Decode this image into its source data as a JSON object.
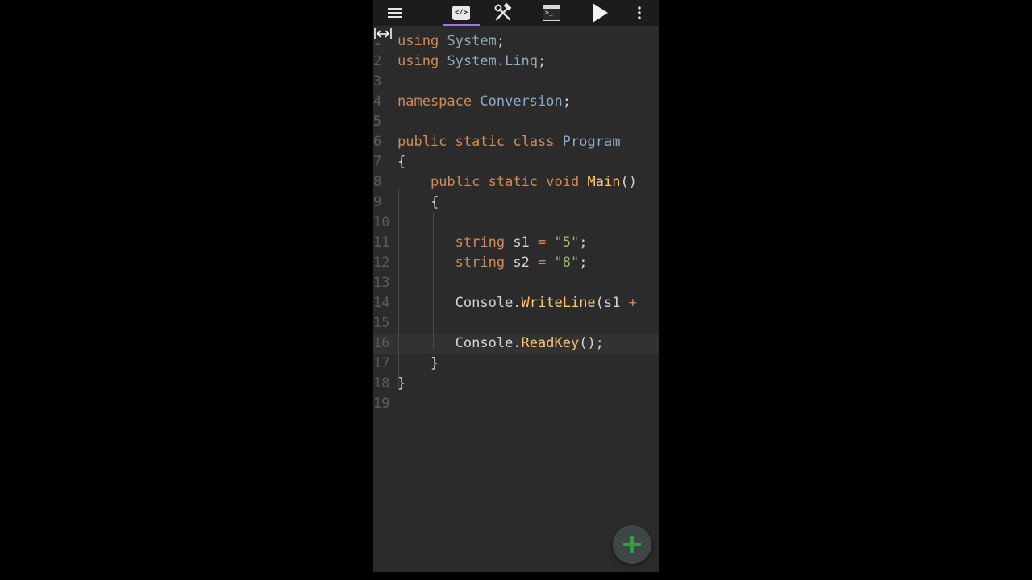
{
  "toolbar": {
    "menu_icon": "hamburger-menu-icon",
    "code_tab_icon": "code-icon",
    "code_tab_glyph": "</>",
    "build_icon": "hammer-wrench-icon",
    "console_icon": "terminal-icon",
    "console_glyph": ">_",
    "run_icon": "play-icon",
    "more_icon": "more-vertical-icon",
    "accent_color": "#9d7ad6"
  },
  "editor": {
    "resize_icon": "resize-horizontal-icon",
    "highlighted_line": 16,
    "lines": [
      {
        "number": "1",
        "tokens": [
          {
            "t": "using",
            "c": "kw"
          },
          {
            "t": " ",
            "c": "pl"
          },
          {
            "t": "System",
            "c": "ty"
          },
          {
            "t": ";",
            "c": "pl"
          }
        ]
      },
      {
        "number": "2",
        "tokens": [
          {
            "t": "using",
            "c": "kw"
          },
          {
            "t": " ",
            "c": "pl"
          },
          {
            "t": "System.Linq",
            "c": "ty"
          },
          {
            "t": ";",
            "c": "pl"
          }
        ]
      },
      {
        "number": "3",
        "tokens": []
      },
      {
        "number": "4",
        "tokens": [
          {
            "t": "namespace",
            "c": "kw"
          },
          {
            "t": " ",
            "c": "pl"
          },
          {
            "t": "Conversion",
            "c": "ty"
          },
          {
            "t": ";",
            "c": "pl"
          }
        ]
      },
      {
        "number": "5",
        "tokens": []
      },
      {
        "number": "6",
        "tokens": [
          {
            "t": "public",
            "c": "kw"
          },
          {
            "t": " ",
            "c": "pl"
          },
          {
            "t": "static",
            "c": "kw"
          },
          {
            "t": " ",
            "c": "pl"
          },
          {
            "t": "class",
            "c": "kw"
          },
          {
            "t": " ",
            "c": "pl"
          },
          {
            "t": "Program",
            "c": "ty"
          }
        ]
      },
      {
        "number": "7",
        "tokens": [
          {
            "t": "{",
            "c": "pl"
          }
        ]
      },
      {
        "number": "8",
        "tokens": [
          {
            "t": "    ",
            "c": "pl"
          },
          {
            "t": "public",
            "c": "kw"
          },
          {
            "t": " ",
            "c": "pl"
          },
          {
            "t": "static",
            "c": "kw"
          },
          {
            "t": " ",
            "c": "pl"
          },
          {
            "t": "void",
            "c": "kw"
          },
          {
            "t": " ",
            "c": "pl"
          },
          {
            "t": "Main",
            "c": "fn"
          },
          {
            "t": "()",
            "c": "pl"
          }
        ]
      },
      {
        "number": "9",
        "tokens": [
          {
            "t": "    ",
            "c": "pl"
          },
          {
            "t": "{",
            "c": "pl"
          }
        ]
      },
      {
        "number": "10",
        "tokens": []
      },
      {
        "number": "11",
        "tokens": [
          {
            "t": "       ",
            "c": "pl"
          },
          {
            "t": "string",
            "c": "kw"
          },
          {
            "t": " s1 ",
            "c": "pl"
          },
          {
            "t": "=",
            "c": "op"
          },
          {
            "t": " ",
            "c": "pl"
          },
          {
            "t": "\"5\"",
            "c": "st"
          },
          {
            "t": ";",
            "c": "pl"
          }
        ]
      },
      {
        "number": "12",
        "tokens": [
          {
            "t": "       ",
            "c": "pl"
          },
          {
            "t": "string",
            "c": "kw"
          },
          {
            "t": " s2 ",
            "c": "pl"
          },
          {
            "t": "=",
            "c": "op"
          },
          {
            "t": " ",
            "c": "pl"
          },
          {
            "t": "\"8\"",
            "c": "st"
          },
          {
            "t": ";",
            "c": "pl"
          }
        ]
      },
      {
        "number": "13",
        "tokens": []
      },
      {
        "number": "14",
        "tokens": [
          {
            "t": "       ",
            "c": "pl"
          },
          {
            "t": "Console.",
            "c": "pl"
          },
          {
            "t": "WriteLine",
            "c": "fn"
          },
          {
            "t": "(s1 ",
            "c": "pl"
          },
          {
            "t": "+",
            "c": "op"
          }
        ]
      },
      {
        "number": "15",
        "tokens": []
      },
      {
        "number": "16",
        "tokens": [
          {
            "t": "       ",
            "c": "pl"
          },
          {
            "t": "Console.",
            "c": "pl"
          },
          {
            "t": "ReadKey",
            "c": "fn"
          },
          {
            "t": "();",
            "c": "pl"
          }
        ]
      },
      {
        "number": "17",
        "tokens": [
          {
            "t": "    ",
            "c": "pl"
          },
          {
            "t": "}",
            "c": "pl"
          }
        ]
      },
      {
        "number": "18",
        "tokens": [
          {
            "t": "}",
            "c": "pl"
          }
        ]
      },
      {
        "number": "19",
        "tokens": []
      }
    ]
  },
  "fab": {
    "icon": "plus-icon",
    "color": "#2ea043"
  }
}
